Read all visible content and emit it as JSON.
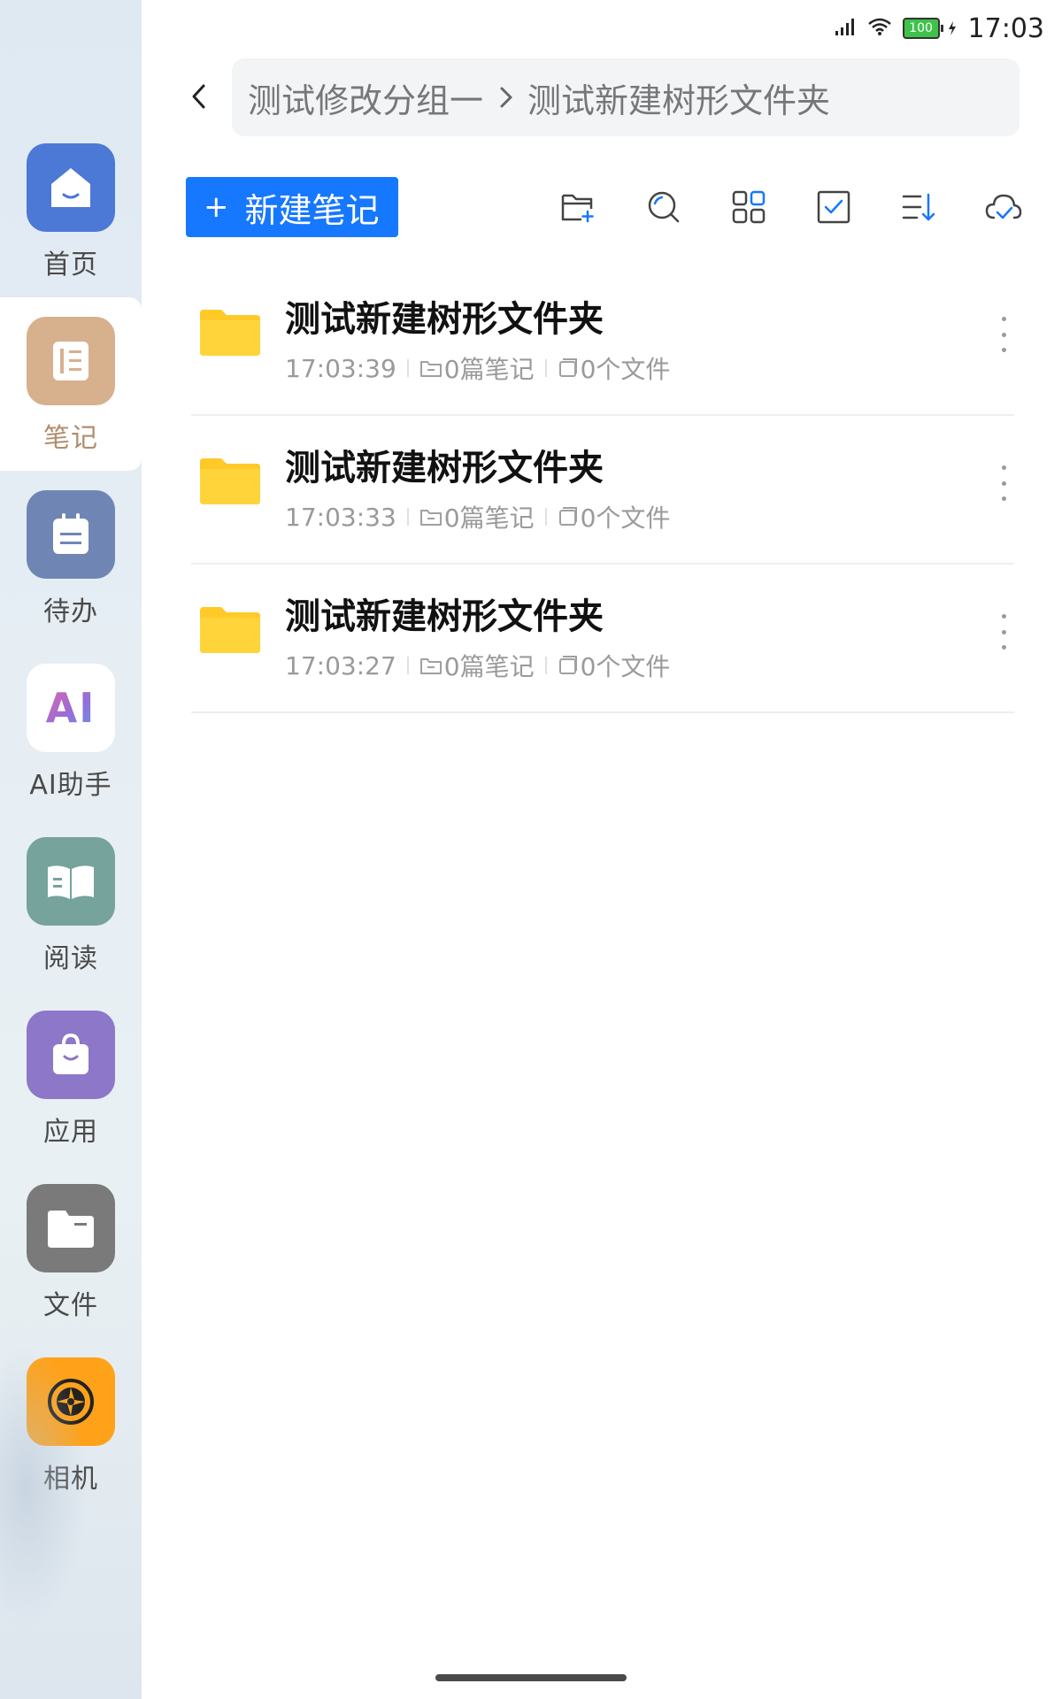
{
  "status_bar": {
    "time": "17:03",
    "battery": "100"
  },
  "sidebar": {
    "items": [
      {
        "label": "首页",
        "icon": "home-icon",
        "color": "#4c78d6"
      },
      {
        "label": "笔记",
        "icon": "notebook-icon",
        "color": "#d7b08e",
        "active": true
      },
      {
        "label": "待办",
        "icon": "todo-icon",
        "color": "#6f86b4"
      },
      {
        "label": "AI助手",
        "icon": "ai-icon",
        "color": "#ffffff",
        "text": "AI"
      },
      {
        "label": "阅读",
        "icon": "book-icon",
        "color": "#76a39b"
      },
      {
        "label": "应用",
        "icon": "bag-icon",
        "color": "#8c77c8"
      },
      {
        "label": "文件",
        "icon": "folder-icon",
        "color": "#7a7a7a"
      },
      {
        "label": "相机",
        "icon": "camera-icon",
        "color": "#ffa21a"
      }
    ]
  },
  "breadcrumb": {
    "parent": "测试修改分组一",
    "current": "测试新建树形文件夹"
  },
  "toolbar": {
    "new_note_label": "新建笔记",
    "new_note_plus": "+",
    "accent": "#1677ff"
  },
  "list": {
    "items": [
      {
        "title": "测试新建树形文件夹",
        "time": "17:03:39",
        "notes": "0篇笔记",
        "files": "0个文件"
      },
      {
        "title": "测试新建树形文件夹",
        "time": "17:03:33",
        "notes": "0篇笔记",
        "files": "0个文件"
      },
      {
        "title": "测试新建树形文件夹",
        "time": "17:03:27",
        "notes": "0篇笔记",
        "files": "0个文件"
      }
    ]
  }
}
